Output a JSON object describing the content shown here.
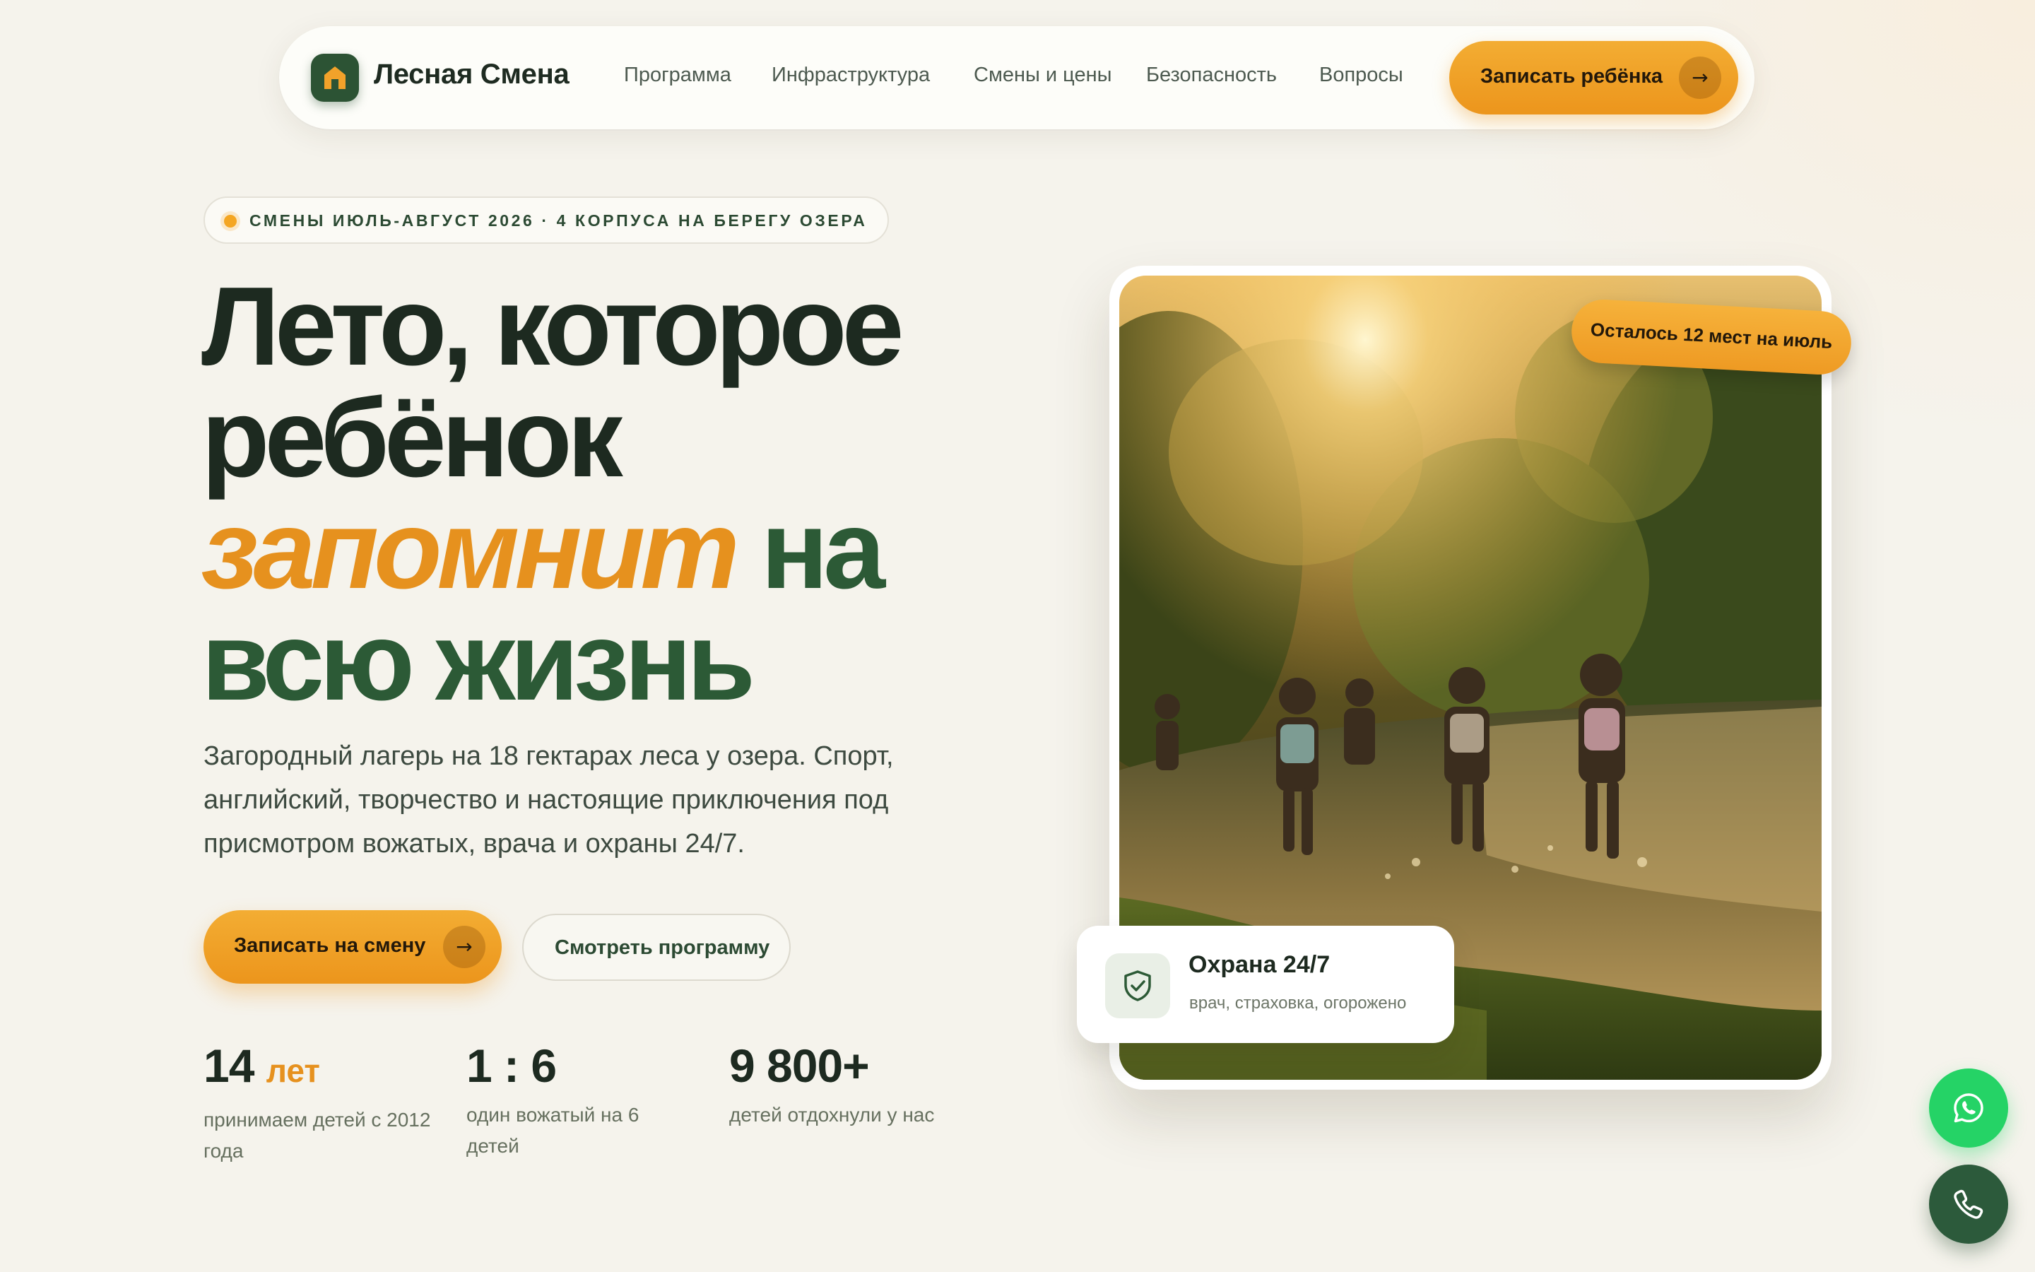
{
  "nav": {
    "logo_text": "Лесная Смена",
    "logo_icon": "house-icon",
    "links": [
      "Программа",
      "Инфраструктура",
      "Смены и цены",
      "Безопасность",
      "Вопросы"
    ],
    "cta_label": "Записать ребёнка",
    "cta_icon": "arrow-right-icon"
  },
  "hero": {
    "badge": "СМЕНЫ ИЮЛЬ-АВГУСТ 2026 · 4 КОРПУСА НА БЕРЕГУ ОЗЕРА",
    "headline": {
      "line1": "Лето, которое",
      "line2": "ребёнок",
      "line3_accent": "запомнит",
      "line3_rest": "на",
      "line4": "всю жизнь"
    },
    "lead": "Загородный лагерь на 18 гектарах леса у озера. Спорт, английский, творчество и настоящие приключения под присмотром вожатых, врача и охраны 24/7.",
    "primary_button": "Записать на смену",
    "secondary_button": "Смотреть программу",
    "stats": [
      {
        "value": "14",
        "unit": "лет",
        "desc": "принимаем детей с 2012 года"
      },
      {
        "value": "1 : 6",
        "unit": "",
        "desc": "один вожатый на 6 детей"
      },
      {
        "value": "9 800+",
        "unit": "",
        "desc": "детей отдохнули у нас"
      }
    ]
  },
  "photo": {
    "tag": "Осталось 12 мест на июль",
    "security_card": {
      "title": "Охрана 24/7",
      "subtitle": "врач, страховка, огорожено",
      "icon": "shield-check-icon"
    }
  },
  "contacts": {
    "whatsapp_icon": "whatsapp-icon",
    "phone_icon": "phone-icon"
  },
  "colors": {
    "accent": "#EE9A23",
    "brand_green": "#2C5A36",
    "background": "#F5F3EC",
    "whatsapp": "#25D366"
  }
}
